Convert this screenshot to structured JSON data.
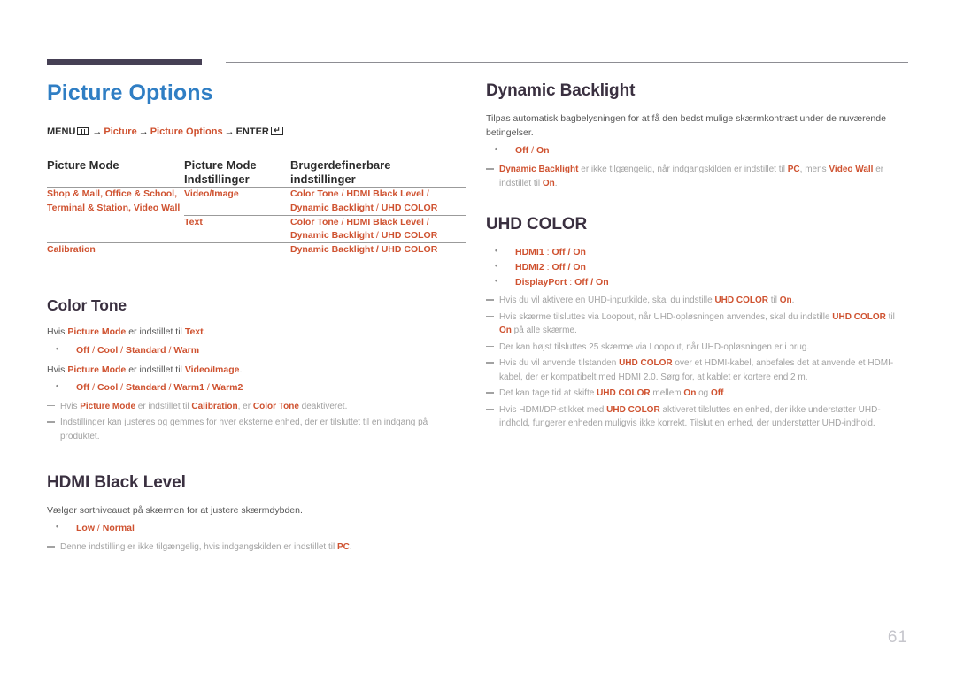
{
  "page": {
    "number": "61",
    "accent_orange": "#CF5230",
    "title_blue": "#2F7EC4",
    "heading_dark": "#3A3040",
    "header_bar_color": "#464055",
    "note_gray": "#A2A2A2"
  },
  "left": {
    "chapter_title": "Picture Options",
    "breadcrumb": {
      "menu_label": "MENU",
      "menu_icon": "menu-grid-icon",
      "arrow": "→",
      "item1": "Picture",
      "item2": "Picture Options",
      "enter_label": "ENTER",
      "enter_icon": "enter-key-icon",
      "enter_glyph": "↵"
    },
    "table": {
      "headers": [
        "Picture Mode",
        "Picture Mode Indstillinger",
        "Brugerdefinerbare indstillinger"
      ],
      "header_col1": "Picture Mode",
      "header_col2_line1": "Picture Mode",
      "header_col2_line2": "Indstillinger",
      "header_col3_line1": "Brugerdefinerbare",
      "header_col3_line2": "indstillinger",
      "rows": [
        {
          "mode_line1": "Shop & Mall, Office & School,",
          "mode_line2": "Terminal & Station, Video Wall",
          "setting": "Video/Image",
          "custom_line1": "Color Tone / HDMI Black Level /",
          "custom_line2": "Dynamic Backlight / UHD COLOR"
        },
        {
          "mode_line1": "",
          "mode_line2": "",
          "setting": "Text",
          "custom_line1": "Color Tone / HDMI Black Level /",
          "custom_line2": "Dynamic Backlight / UHD COLOR"
        },
        {
          "mode_line1": "Calibration",
          "mode_line2": "",
          "setting": "",
          "custom_line1": "Dynamic Backlight / UHD COLOR",
          "custom_line2": ""
        }
      ]
    },
    "color_tone": {
      "title": "Color Tone",
      "intro1_pre": "Hvis ",
      "intro1_kw1": "Picture Mode",
      "intro1_mid": " er indstillet til ",
      "intro1_kw2": "Text",
      "intro1_post": ".",
      "options1": "Off / Cool / Standard / Warm",
      "intro2_pre": "Hvis ",
      "intro2_kw1": "Picture Mode",
      "intro2_mid": " er indstillet til ",
      "intro2_kw2": "Video/Image",
      "intro2_post": ".",
      "options2": "Off / Cool / Standard / Warm1 / Warm2",
      "note1": "Hvis Picture Mode er indstillet til Calibration, er Color Tone deaktiveret.",
      "note2": "Indstillinger kan justeres og gemmes for hver eksterne enhed, der er tilsluttet til en indgang på produktet."
    },
    "hdmi_black_level": {
      "title": "HDMI Black Level",
      "description": "Vælger sortniveauet på skærmen for at justere skærmdybden.",
      "options": "Low / Normal",
      "note1": "Denne indstilling er ikke tilgængelig, hvis indgangskilden er indstillet til PC."
    }
  },
  "right": {
    "dynamic_backlight": {
      "title": "Dynamic Backlight",
      "description": "Tilpas automatisk bagbelysningen for at få den bedst mulige skærmkontrast under de nuværende betingelser.",
      "options": "Off / On",
      "note1": "Dynamic Backlight er ikke tilgængelig, når indgangskilden er indstillet til PC, mens Video Wall er indstillet til On."
    },
    "uhd_color": {
      "title": "UHD COLOR",
      "options": [
        {
          "label": "HDMI1",
          "values": "Off / On"
        },
        {
          "label": "HDMI2",
          "values": "Off / On"
        },
        {
          "label": "DisplayPort",
          "values": "Off / On"
        }
      ],
      "notes": [
        "Hvis du vil aktivere en UHD-inputkilde, skal du indstille UHD COLOR til On.",
        "Hvis skærme tilsluttes via Loopout, når UHD-opløsningen anvendes, skal du indstille UHD COLOR til On på alle skærme.",
        "Der kan højst tilsluttes 25 skærme via Loopout, når UHD-opløsningen er i brug.",
        "Hvis du vil anvende tilstanden UHD COLOR over et HDMI-kabel, anbefales det at anvende et HDMI-kabel, der er kompatibelt med HDMI 2.0. Sørg for, at kablet er kortere end 2 m.",
        "Det kan tage tid at skifte UHD COLOR mellem On og Off.",
        "Hvis HDMI/DP-stikket med UHD COLOR aktiveret tilsluttes en enhed, der ikke understøtter UHD-indhold, fungerer enheden muligvis ikke korrekt. Tilslut en enhed, der understøtter UHD-indhold."
      ]
    }
  }
}
